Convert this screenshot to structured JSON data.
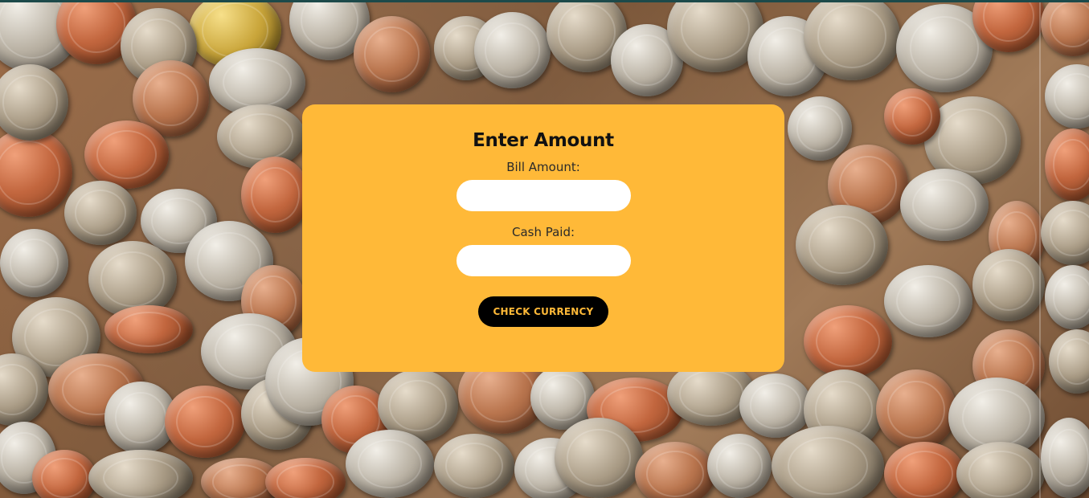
{
  "form": {
    "title": "Enter Amount",
    "bill_label": "Bill Amount:",
    "bill_value": "",
    "cash_label": "Cash Paid:",
    "cash_value": "",
    "button_label": "CHECK CURRENCY"
  },
  "colors": {
    "card_background": "#ffb938",
    "button_background": "#000000",
    "button_text": "#ffb938",
    "input_background": "#ffffff"
  }
}
